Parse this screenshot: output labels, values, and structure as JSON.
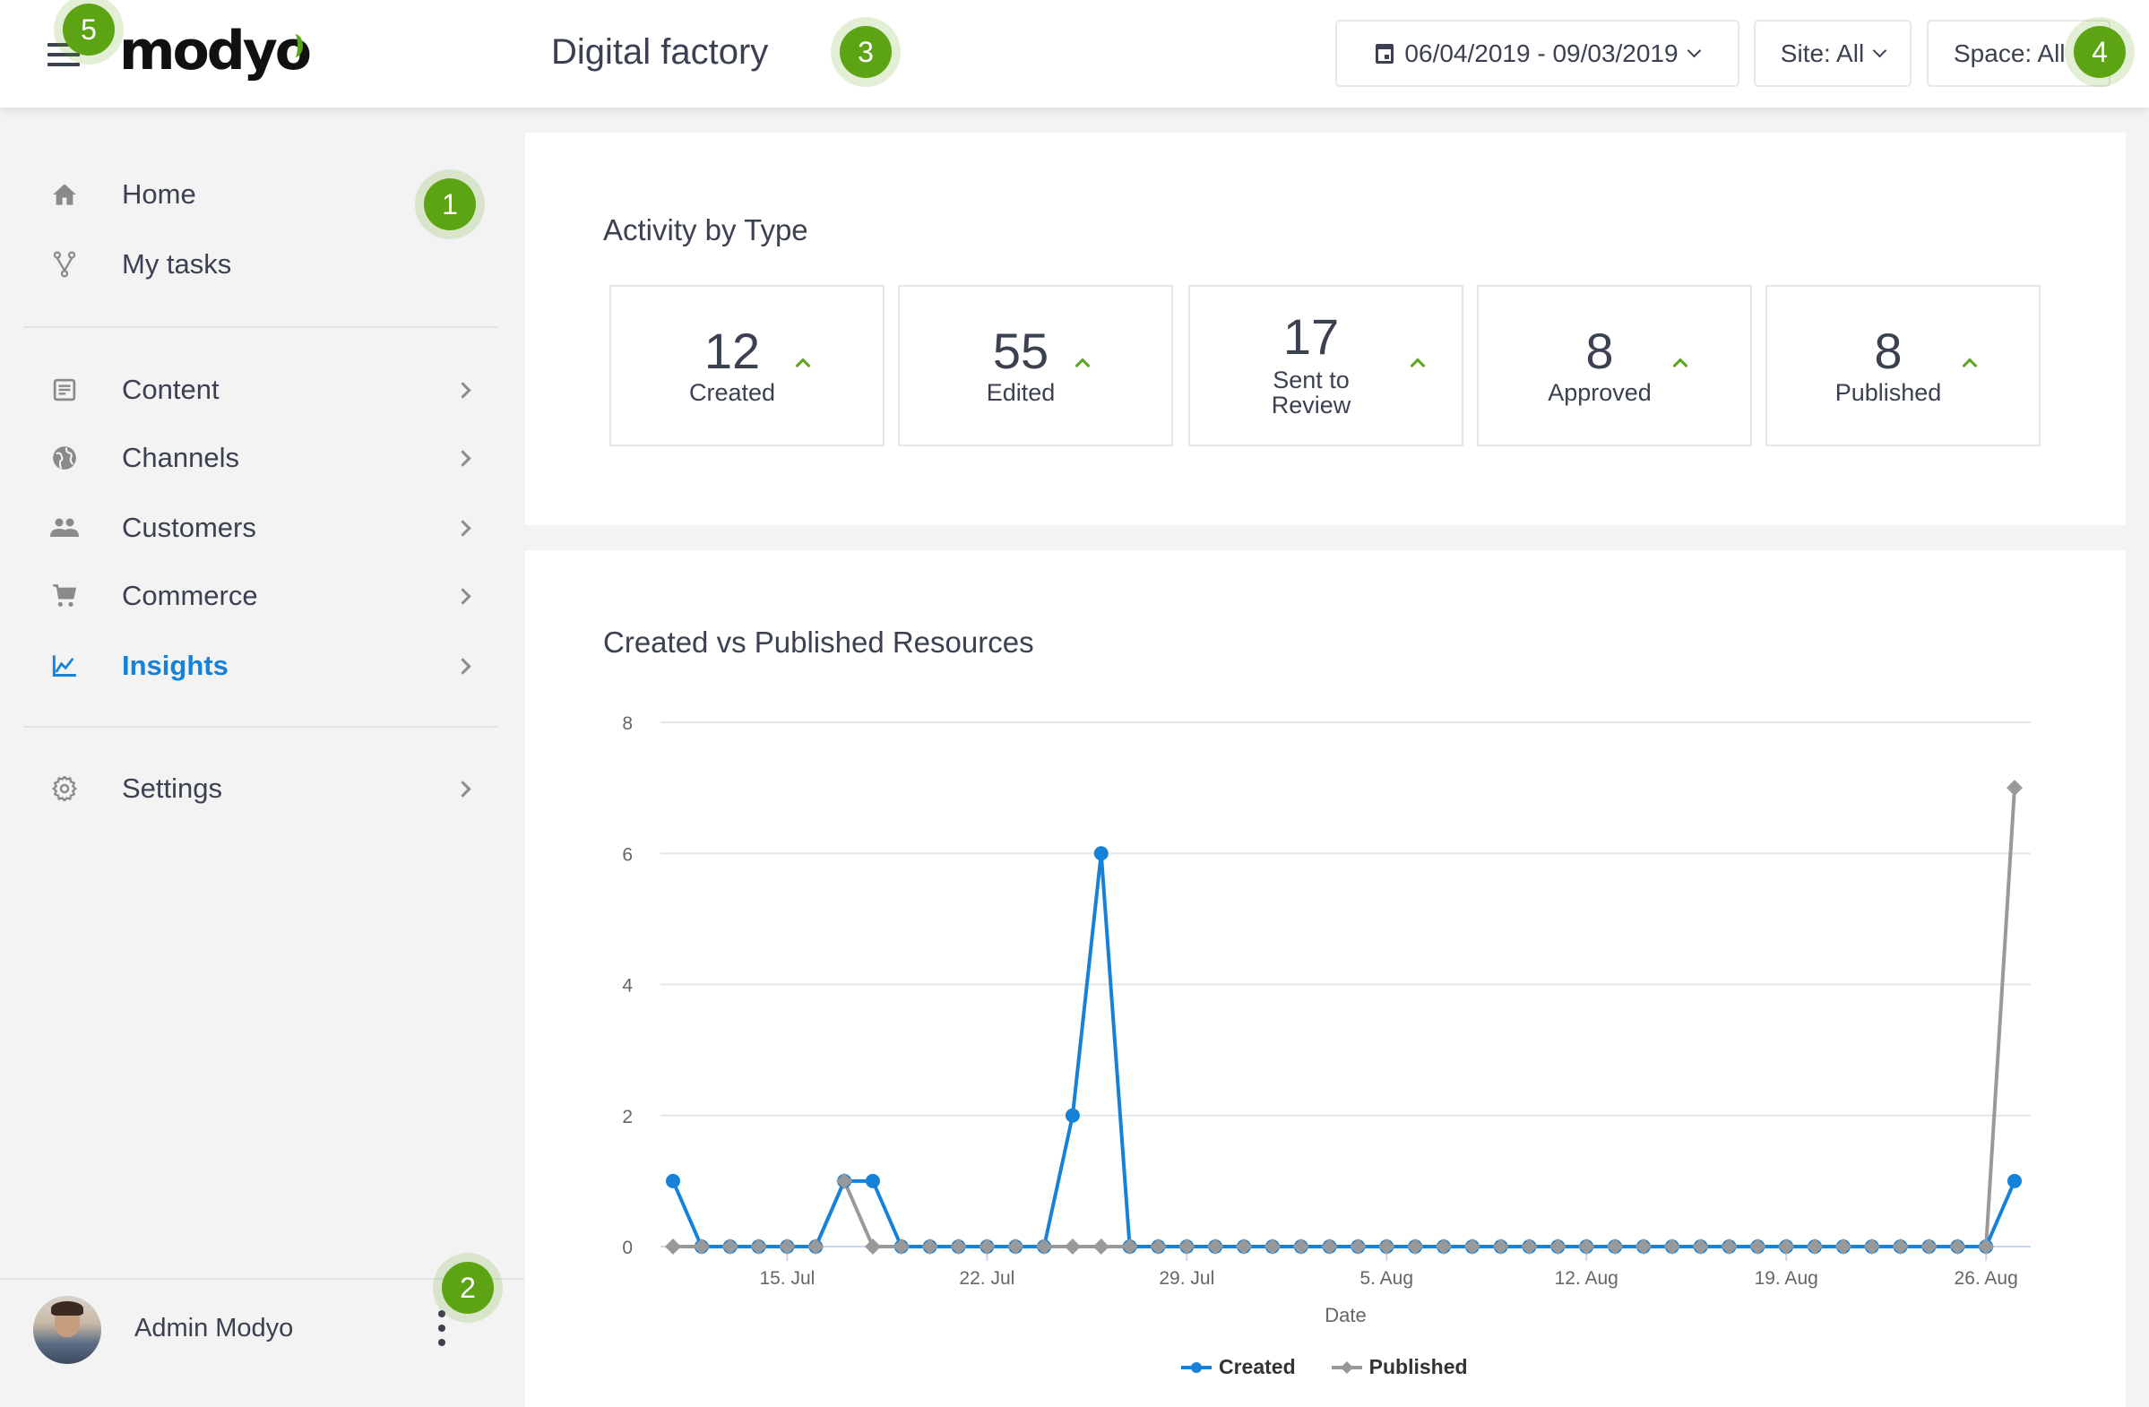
{
  "header": {
    "logo_text": "modyo",
    "title": "Digital factory",
    "date_range": "06/04/2019 - 09/03/2019",
    "site_filter": "Site: All",
    "space_filter": "Space: All"
  },
  "sidebar": {
    "items": [
      {
        "label": "Home",
        "icon": "home-icon"
      },
      {
        "label": "My tasks",
        "icon": "fork-icon"
      },
      {
        "label": "Content",
        "icon": "document-icon"
      },
      {
        "label": "Channels",
        "icon": "globe-icon"
      },
      {
        "label": "Customers",
        "icon": "people-icon"
      },
      {
        "label": "Commerce",
        "icon": "cart-icon"
      },
      {
        "label": "Insights",
        "icon": "chart-line-icon",
        "active": true
      },
      {
        "label": "Settings",
        "icon": "gear-icon"
      }
    ],
    "user": {
      "name": "Admin Modyo"
    }
  },
  "badges": [
    "1",
    "2",
    "3",
    "4",
    "5"
  ],
  "activity": {
    "title": "Activity by Type",
    "cards": [
      {
        "value": "12",
        "label": "Created",
        "trend": "up"
      },
      {
        "value": "55",
        "label": "Edited",
        "trend": "up"
      },
      {
        "value": "17",
        "label": "Sent to Review",
        "label_lines": [
          "Sent to",
          "Review"
        ],
        "trend": "up"
      },
      {
        "value": "8",
        "label": "Approved",
        "trend": "up"
      },
      {
        "value": "8",
        "label": "Published",
        "trend": "up"
      }
    ]
  },
  "colors": {
    "accent": "#1681d8",
    "badge": "#5da414",
    "trend_up": "#5aa51c",
    "created_series": "#1681d8",
    "published_series": "#999999"
  },
  "chart_data": {
    "type": "line",
    "title": "Created vs Published Resources",
    "xlabel": "Date",
    "ylabel": "",
    "ylim": [
      0,
      8
    ],
    "yticks": [
      "0",
      "2",
      "4",
      "6",
      "8"
    ],
    "grid": true,
    "legend": "bottom-center",
    "xtick_labels": [
      {
        "label": "15. Jul",
        "index": 4
      },
      {
        "label": "22. Jul",
        "index": 11
      },
      {
        "label": "29. Jul",
        "index": 18
      },
      {
        "label": "5. Aug",
        "index": 25
      },
      {
        "label": "12. Aug",
        "index": 32
      },
      {
        "label": "19. Aug",
        "index": 39
      },
      {
        "label": "26. Aug",
        "index": 46
      }
    ],
    "x": [
      "11 Jul",
      "12 Jul",
      "13 Jul",
      "14 Jul",
      "15 Jul",
      "16 Jul",
      "17 Jul",
      "18 Jul",
      "19 Jul",
      "20 Jul",
      "21 Jul",
      "22 Jul",
      "23 Jul",
      "24 Jul",
      "25 Jul",
      "26 Jul",
      "27 Jul",
      "28 Jul",
      "29 Jul",
      "30 Jul",
      "31 Jul",
      "1 Aug",
      "2 Aug",
      "3 Aug",
      "4 Aug",
      "5 Aug",
      "6 Aug",
      "7 Aug",
      "8 Aug",
      "9 Aug",
      "10 Aug",
      "11 Aug",
      "12 Aug",
      "13 Aug",
      "14 Aug",
      "15 Aug",
      "16 Aug",
      "17 Aug",
      "18 Aug",
      "19 Aug",
      "20 Aug",
      "21 Aug",
      "22 Aug",
      "23 Aug",
      "24 Aug",
      "25 Aug",
      "26 Aug",
      "27 Aug"
    ],
    "series": [
      {
        "name": "Created",
        "marker": "circle",
        "color": "#1681d8",
        "values": [
          1,
          0,
          0,
          0,
          0,
          0,
          1,
          1,
          0,
          0,
          0,
          0,
          0,
          0,
          2,
          6,
          0,
          0,
          0,
          0,
          0,
          0,
          0,
          0,
          0,
          0,
          0,
          0,
          0,
          0,
          0,
          0,
          0,
          0,
          0,
          0,
          0,
          0,
          0,
          0,
          0,
          0,
          0,
          0,
          0,
          0,
          0,
          1
        ]
      },
      {
        "name": "Published",
        "marker": "diamond",
        "color": "#999999",
        "values": [
          0,
          0,
          0,
          0,
          0,
          0,
          1,
          0,
          0,
          0,
          0,
          0,
          0,
          0,
          0,
          0,
          0,
          0,
          0,
          0,
          0,
          0,
          0,
          0,
          0,
          0,
          0,
          0,
          0,
          0,
          0,
          0,
          0,
          0,
          0,
          0,
          0,
          0,
          0,
          0,
          0,
          0,
          0,
          0,
          0,
          0,
          0,
          7
        ]
      }
    ]
  }
}
